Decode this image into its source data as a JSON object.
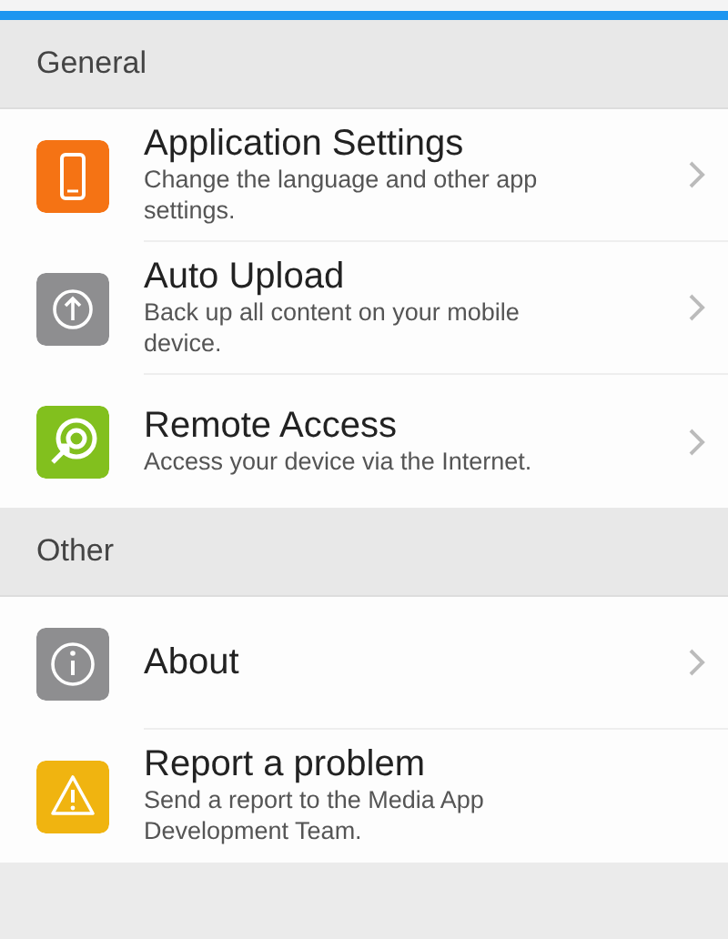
{
  "sections": [
    {
      "title": "General",
      "items": [
        {
          "kind": "phone",
          "color": "#f57314",
          "title": "Application Settings",
          "subtitle": "Change the language and other app settings.",
          "chevron": true
        },
        {
          "kind": "upload",
          "color": "#8e8e90",
          "title": "Auto Upload",
          "subtitle": "Back up all content on your mobile device.",
          "chevron": true
        },
        {
          "kind": "remote",
          "color": "#82c01e",
          "title": "Remote Access",
          "subtitle": "Access your device via the Internet.",
          "chevron": true
        }
      ]
    },
    {
      "title": "Other",
      "items": [
        {
          "kind": "info",
          "color": "#8e8e90",
          "title": "About",
          "chevron": true
        },
        {
          "kind": "warning",
          "color": "#f0b410",
          "title": "Report a problem",
          "subtitle": "Send a report to the Media App Development Team.",
          "chevron": false
        }
      ]
    }
  ]
}
